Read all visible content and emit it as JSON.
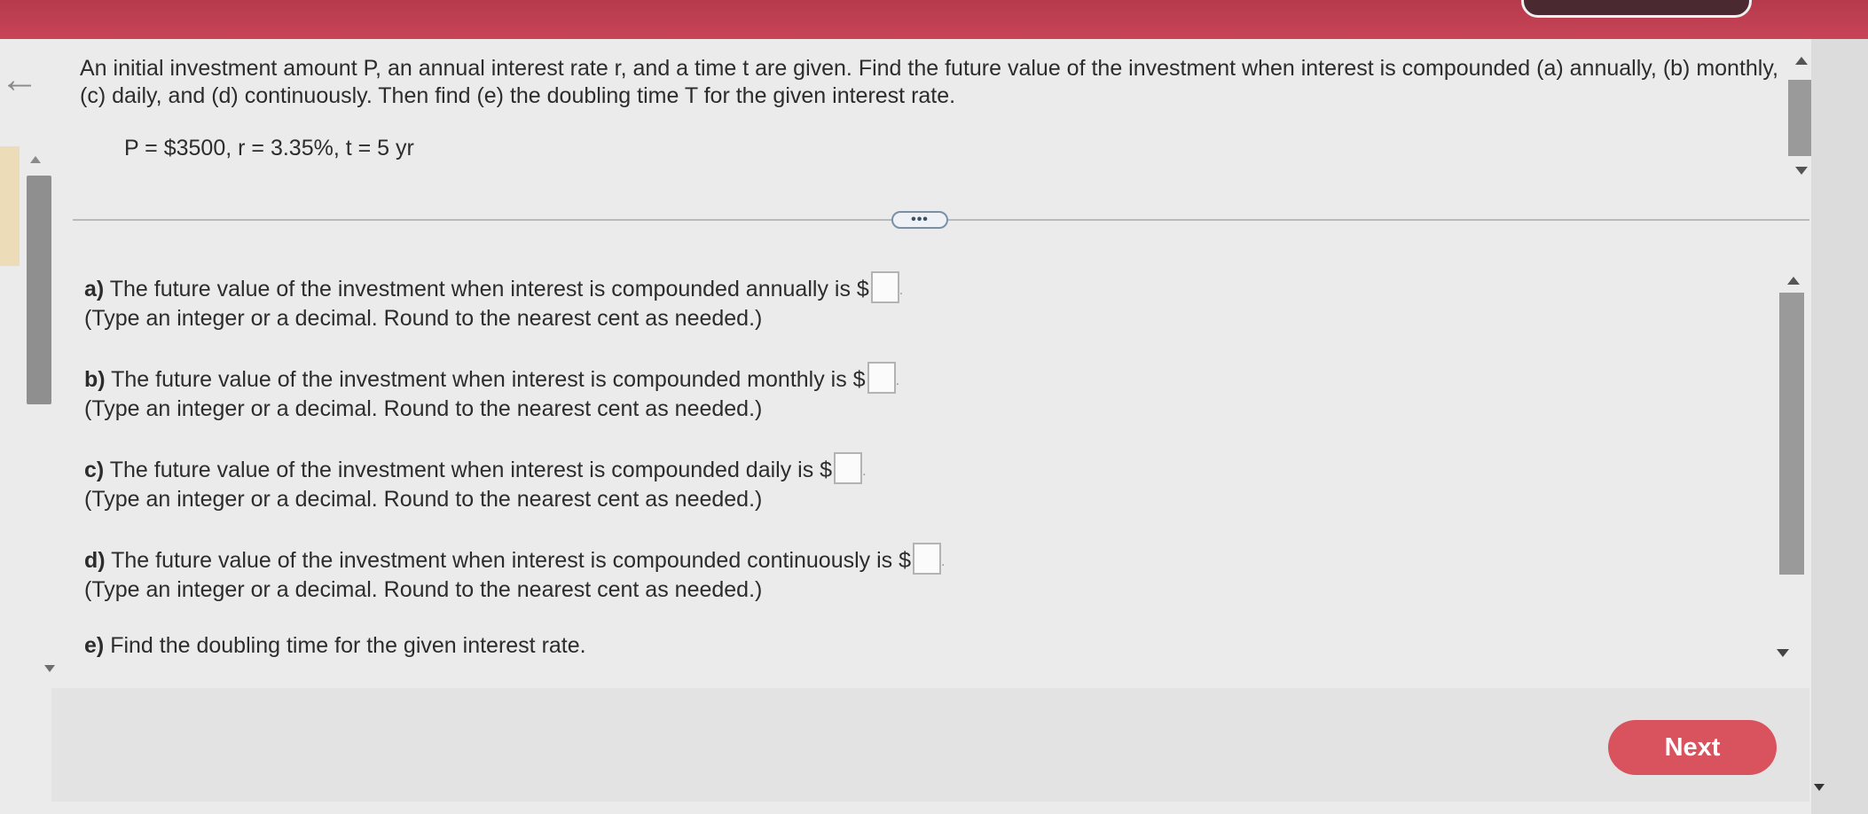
{
  "question": {
    "text": "An initial investment amount P, an annual interest rate r, and a time t are given. Find the future value of the investment when interest is compounded (a) annually, (b) monthly, (c) daily, and (d) continuously. Then find (e) the doubling time T for the given interest rate.",
    "given": "P = $3500, r = 3.35%, t = 5 yr"
  },
  "more_button": "•••",
  "answers": {
    "a": {
      "label": "a)",
      "text": "The future value of the investment when interest is compounded annually is $",
      "value": "",
      "hint": "(Type an integer or a decimal. Round to the nearest cent as needed.)"
    },
    "b": {
      "label": "b)",
      "text": "The future value of the investment when interest is compounded monthly is $",
      "value": "",
      "hint": "(Type an integer or a decimal. Round to the nearest cent as needed.)"
    },
    "c": {
      "label": "c)",
      "text": "The future value of the investment when interest is compounded daily is $",
      "value": "",
      "hint": "(Type an integer or a decimal. Round to the nearest cent as needed.)"
    },
    "d": {
      "label": "d)",
      "text": "The future value of the investment when interest is compounded continuously is $",
      "value": "",
      "hint": "(Type an integer or a decimal. Round to the nearest cent as needed.)"
    },
    "e": {
      "label": "e)",
      "text": "Find the doubling time for the given interest rate."
    }
  },
  "punctuation": {
    "period": "."
  },
  "icons": {
    "back": "←"
  },
  "next_button": "Next",
  "colors": {
    "header": "#c84457",
    "next_button": "#d9535e"
  }
}
